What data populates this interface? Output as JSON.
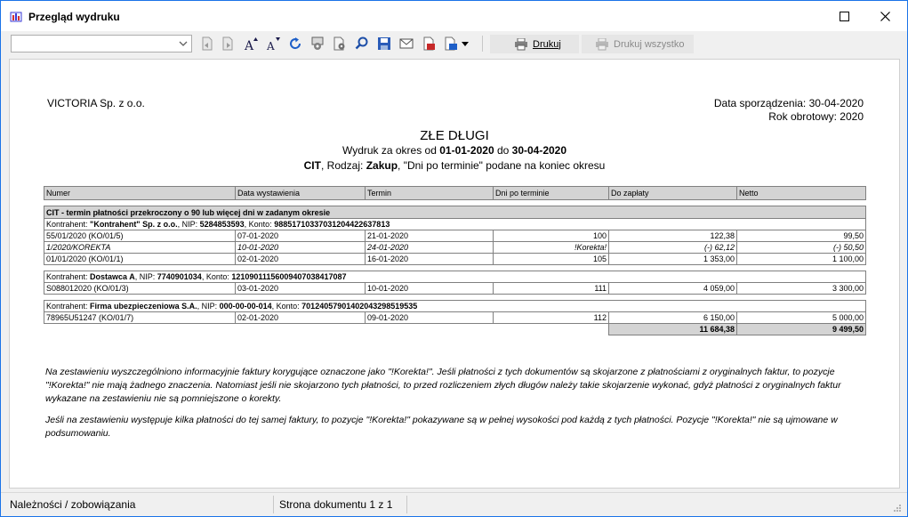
{
  "window": {
    "title": "Przegląd wydruku",
    "minimize_icon": "minimize-icon",
    "maximize_icon": "maximize-icon",
    "close_icon": "close-icon"
  },
  "toolbar": {
    "combo_value": "",
    "print_label": "Drukuj",
    "print_all_label": "Drukuj wszystko"
  },
  "report": {
    "company": "VICTORIA Sp. z o.o.",
    "date_label": "Data sporządzenia: 30-04-2020",
    "year_label": "Rok obrotowy: 2020",
    "title": "ZŁE DŁUGI",
    "period_prefix": "Wydruk za okres od ",
    "period_from": "01-01-2020",
    "period_mid": " do ",
    "period_to": "30-04-2020",
    "sub_cit": "CIT",
    "sub_mid": ", Rodzaj: ",
    "sub_kind": "Zakup",
    "sub_rest": ", \"Dni po terminie\" podane na koniec okresu",
    "columns": [
      "Numer",
      "Data wystawienia",
      "Termin",
      "Dni po terminie",
      "Do zapłaty",
      "Netto"
    ],
    "group_title": "CIT - termin płatności przekroczony o 90 lub więcej dni w zadanym okresie",
    "contractors": [
      {
        "prefix": "Kontrahent: ",
        "name": "\"Kontrahent\" Sp. z o.o.",
        "nip_label": ", NIP: ",
        "nip": "5284853593",
        "konto_label": ", Konto: ",
        "konto": "98851710337031204422637813",
        "rows": [
          {
            "numer": "55/01/2020 (KO/01/5)",
            "data": "07-01-2020",
            "termin": "21-01-2020",
            "dni": "100",
            "do_zaplaty": "122,38",
            "netto": "99,50"
          },
          {
            "numer": "1/2020/KOREKTA",
            "data": "10-01-2020",
            "termin": "24-01-2020",
            "dni": "!Korekta!",
            "do_zaplaty": "(-) 62,12",
            "netto": "(-) 50,50"
          },
          {
            "numer": "01/01/2020 (KO/01/1)",
            "data": "02-01-2020",
            "termin": "16-01-2020",
            "dni": "105",
            "do_zaplaty": "1 353,00",
            "netto": "1 100,00"
          }
        ]
      },
      {
        "prefix": "Kontrahent: ",
        "name": "Dostawca A",
        "nip_label": ", NIP: ",
        "nip": "7740901034",
        "konto_label": ", Konto: ",
        "konto": "12109011156009407038417087",
        "rows": [
          {
            "numer": "S088012020 (KO/01/3)",
            "data": "03-01-2020",
            "termin": "10-01-2020",
            "dni": "111",
            "do_zaplaty": "4 059,00",
            "netto": "3 300,00"
          }
        ]
      },
      {
        "prefix": "Kontrahent: ",
        "name": "Firma ubezpieczeniowa S.A.",
        "nip_label": ", NIP: ",
        "nip": "000-00-00-014",
        "konto_label": ", Konto: ",
        "konto": "70124057901402043298519535",
        "rows": [
          {
            "numer": "78965U51247 (KO/01/7)",
            "data": "02-01-2020",
            "termin": "09-01-2020",
            "dni": "112",
            "do_zaplaty": "6 150,00",
            "netto": "5 000,00"
          }
        ]
      }
    ],
    "total_do_zaplaty": "11 684,38",
    "total_netto": "9 499,50",
    "note1": "Na zestawieniu wyszczególniono informacyjnie faktury korygujące oznaczone jako \"!Korekta!\". Jeśli płatności z tych dokumentów są skojarzone z płatnościami z oryginalnych faktur, to pozycje \"!Korekta!\" nie mają żadnego znaczenia. Natomiast jeśli nie skojarzono tych płatności, to przed rozliczeniem złych długów należy takie skojarzenie wykonać, gdyż płatności z oryginalnych faktur wykazane na zestawieniu nie są pomniejszone o korekty.",
    "note2": "Jeśli na zestawieniu występuje kilka płatności do tej samej faktury, to pozycje \"!Korekta!\" pokazywane są w pełnej wysokości pod każdą z tych płatności. Pozycje \"!Korekta!\" nie są ujmowane w podsumowaniu."
  },
  "statusbar": {
    "section": "Należności / zobowiązania",
    "page": "Strona dokumentu 1 z 1"
  }
}
